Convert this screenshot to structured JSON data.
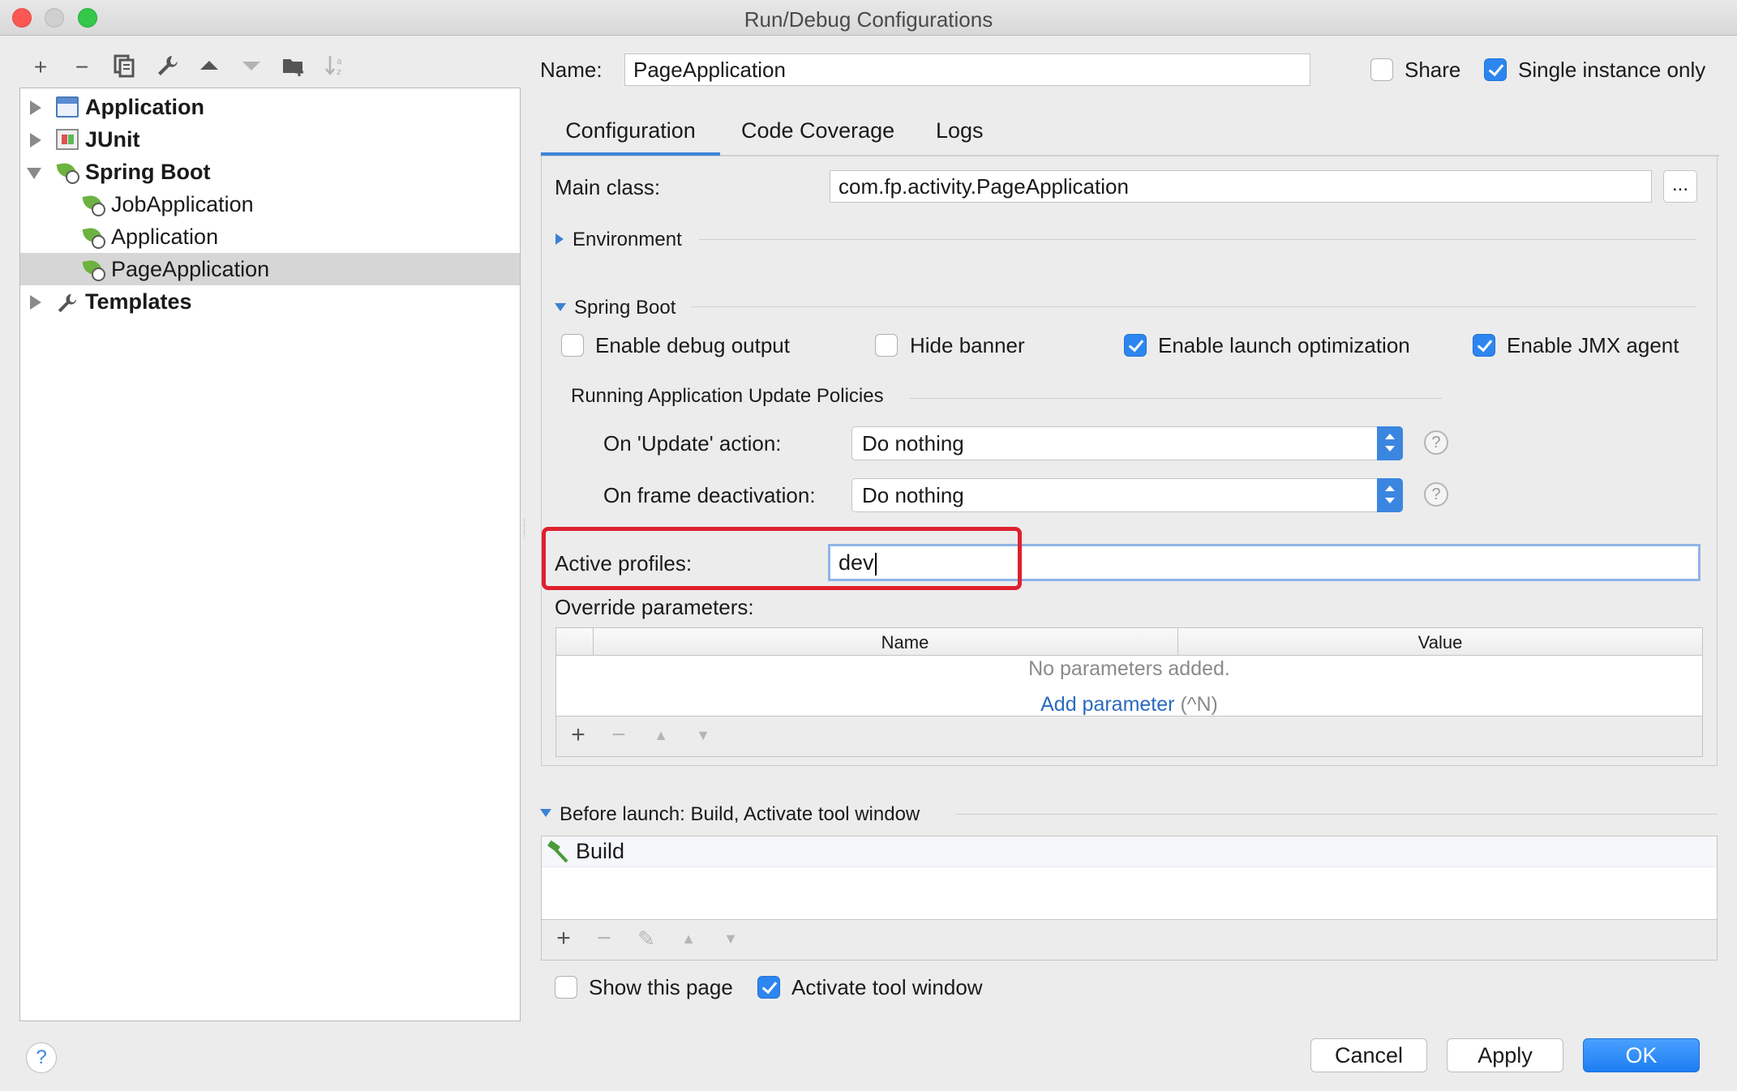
{
  "window": {
    "title": "Run/Debug Configurations"
  },
  "left_toolbar": {
    "icons": [
      "add-icon",
      "remove-icon",
      "copy-icon",
      "wrench-icon",
      "move-up-icon",
      "move-down-icon",
      "new-folder-icon",
      "sort-icon"
    ],
    "glyphs": {
      "add": "+",
      "remove": "−",
      "copy": "⧉",
      "wrench": "🔧",
      "up": "▲",
      "down": "▼",
      "folder": "▇",
      "sort": "↓ᵃᶻ"
    }
  },
  "tree": {
    "items": [
      {
        "label": "Application",
        "level": 0,
        "expanded": false,
        "icon": "application-icon"
      },
      {
        "label": "JUnit",
        "level": 0,
        "expanded": false,
        "icon": "junit-icon"
      },
      {
        "label": "Spring Boot",
        "level": 0,
        "expanded": true,
        "icon": "spring-boot-icon"
      },
      {
        "label": "JobApplication",
        "level": 1,
        "icon": "spring-boot-app-icon"
      },
      {
        "label": "Application",
        "level": 1,
        "icon": "spring-boot-app-icon"
      },
      {
        "label": "PageApplication",
        "level": 1,
        "icon": "spring-boot-app-icon",
        "selected": true
      },
      {
        "label": "Templates",
        "level": 0,
        "expanded": false,
        "icon": "wrench-icon"
      }
    ]
  },
  "header": {
    "name_label": "Name:",
    "name_value": "PageApplication",
    "share_label": "Share",
    "share_checked": false,
    "single_instance_label": "Single instance only",
    "single_instance_checked": true
  },
  "tabs": [
    {
      "label": "Configuration",
      "active": true
    },
    {
      "label": "Code Coverage",
      "active": false
    },
    {
      "label": "Logs",
      "active": false
    }
  ],
  "config": {
    "main_class_label": "Main class:",
    "main_class_value": "com.fp.activity.PageApplication",
    "browse_label": "...",
    "environment_label": "Environment",
    "spring_boot_label": "Spring Boot",
    "checkboxes": {
      "debug_output": {
        "label": "Enable debug output",
        "checked": false
      },
      "hide_banner": {
        "label": "Hide banner",
        "checked": false
      },
      "launch_optimization": {
        "label": "Enable launch optimization",
        "checked": true
      },
      "jmx_agent": {
        "label": "Enable JMX agent",
        "checked": true
      }
    },
    "policies_label": "Running Application Update Policies",
    "update_action_label": "On 'Update' action:",
    "update_action_value": "Do nothing",
    "frame_deactivation_label": "On frame deactivation:",
    "frame_deactivation_value": "Do nothing",
    "help_glyph": "?",
    "active_profiles_label": "Active profiles:",
    "active_profiles_value": "dev",
    "override_label": "Override parameters:",
    "table": {
      "columns": [
        "Name",
        "Value"
      ],
      "empty_text": "No parameters added.",
      "add_link": "Add parameter",
      "add_shortcut": "(^N)"
    }
  },
  "before_launch": {
    "label": "Before launch: Build, Activate tool window",
    "items": [
      {
        "label": "Build",
        "icon": "hammer-icon"
      }
    ],
    "show_page_label": "Show this page",
    "show_page_checked": false,
    "activate_tool_label": "Activate tool window",
    "activate_tool_checked": true
  },
  "footer": {
    "help_glyph": "?",
    "cancel_label": "Cancel",
    "apply_label": "Apply",
    "ok_label": "OK"
  },
  "colors": {
    "accent": "#2d86f0",
    "highlight_box": "#e0202e",
    "spring_green": "#6db33f",
    "link": "#2a6bbf"
  }
}
